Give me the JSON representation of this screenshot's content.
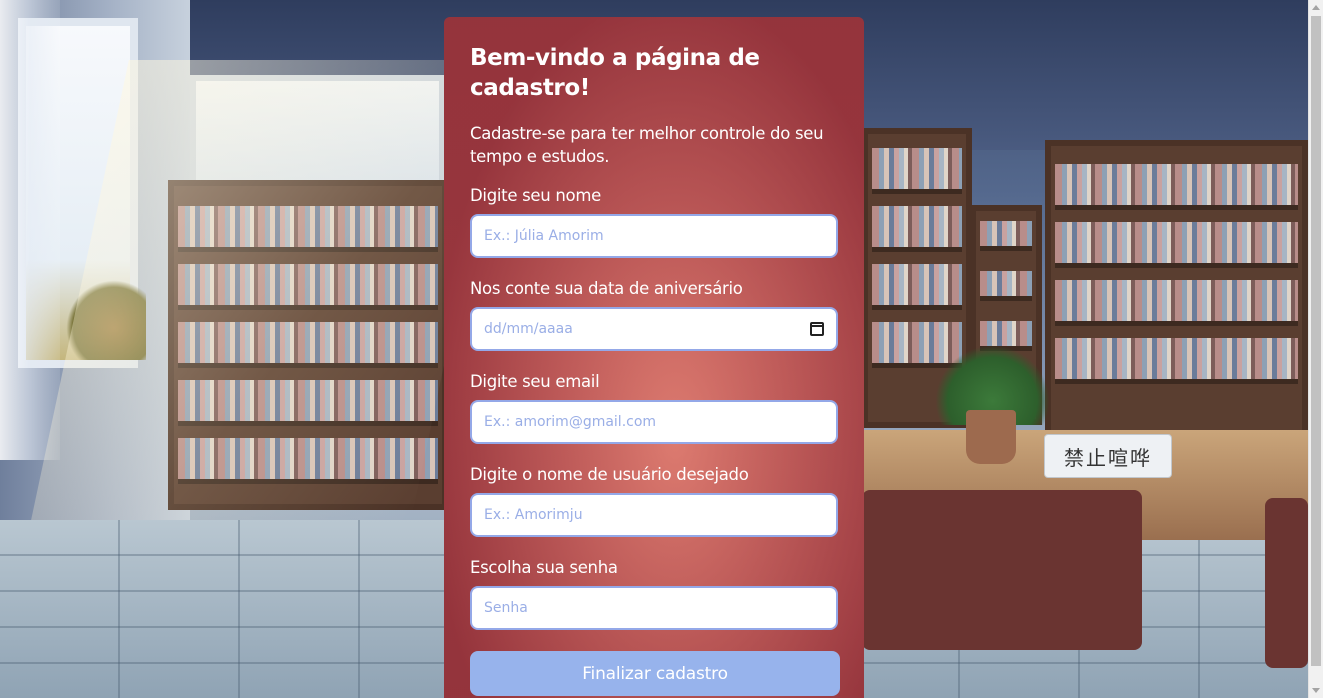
{
  "form": {
    "title": "Bem-vindo a página de cadastro!",
    "subtitle": "Cadastre-se para ter melhor controle do seu tempo e estudos.",
    "fields": [
      {
        "label": "Digite seu nome",
        "placeholder": "Ex.: Júlia Amorim",
        "value": ""
      },
      {
        "label": "Nos conte sua data de aniversário",
        "placeholder": "dd/mm/aaaa",
        "value": "",
        "icon": "calendar-icon"
      },
      {
        "label": "Digite seu email",
        "placeholder": "Ex.: amorim@gmail.com",
        "value": ""
      },
      {
        "label": "Digite o nome de usuário desejado",
        "placeholder": "Ex.: Amorimju",
        "value": ""
      },
      {
        "label": "Escolha sua senha",
        "placeholder": "Senha",
        "value": ""
      }
    ],
    "submit_label": "Finalizar cadastro"
  },
  "background": {
    "sign_text": "禁止喧哗"
  },
  "colors": {
    "input_border": "#94a8e8",
    "placeholder": "#9aaee6",
    "button": "#97b3ec",
    "card": "#a14a4f"
  }
}
